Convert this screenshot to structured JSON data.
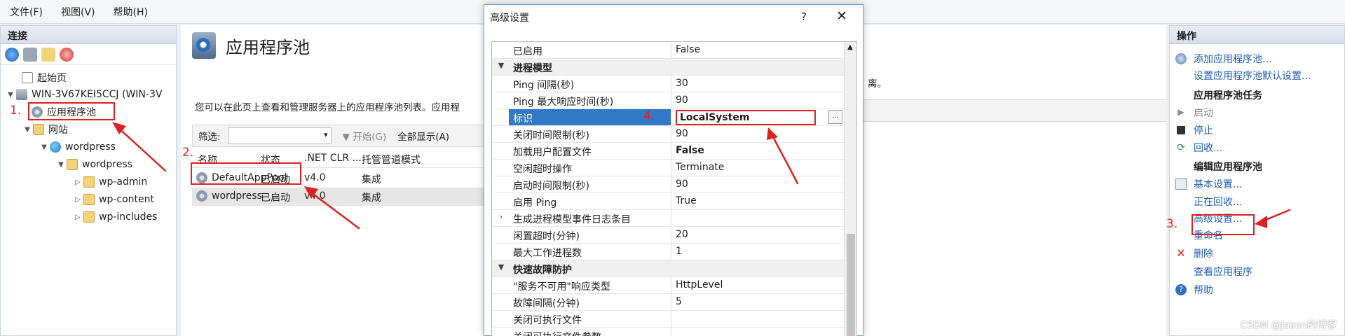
{
  "menubar": {
    "items": [
      "文件(F)",
      "视图(V)",
      "帮助(H)"
    ]
  },
  "connections": {
    "title": "连接",
    "tree": [
      {
        "label": "起始页"
      },
      {
        "label": "WIN-3V67KEI5CCJ (WIN-3V"
      },
      {
        "label": "应用程序池"
      },
      {
        "label": "网站"
      },
      {
        "label": "wordpress"
      },
      {
        "label": "wordpress"
      },
      {
        "label": "wp-admin"
      },
      {
        "label": "wp-content"
      },
      {
        "label": "wp-includes"
      }
    ]
  },
  "main": {
    "title": "应用程序池",
    "description": "您可以在此页上查看和管理服务器上的应用程序池列表。应用程",
    "filter_label": "筛选:",
    "start_label": "▼ 开始(G)",
    "showall_label": "全部显示(A)",
    "columns": [
      "名称",
      "状态",
      ".NET CLR ...",
      "托管管道模式"
    ],
    "rows": [
      {
        "name": "DefaultAppPool",
        "status": "已启动",
        "clr": "v4.0",
        "pipeline": "集成"
      },
      {
        "name": "wordpress",
        "status": "已启动",
        "clr": "v4.0",
        "pipeline": "集成"
      }
    ],
    "right_fragment": "离。"
  },
  "dialog": {
    "title": "高级设置",
    "help": "?",
    "close": "✕",
    "properties": [
      {
        "name": "已启用",
        "value": "False"
      },
      {
        "name": "进程模型",
        "value": ""
      },
      {
        "name": "Ping 间隔(秒)",
        "value": "30"
      },
      {
        "name": "Ping 最大响应时间(秒)",
        "value": "90"
      },
      {
        "name": "标识",
        "value": "LocalSystem"
      },
      {
        "name": "关闭时间限制(秒)",
        "value": "90"
      },
      {
        "name": "加载用户配置文件",
        "value": "False"
      },
      {
        "name": "空闲超时操作",
        "value": "Terminate"
      },
      {
        "name": "启动时间限制(秒)",
        "value": "90"
      },
      {
        "name": "启用 Ping",
        "value": "True"
      },
      {
        "name": "生成进程模型事件日志条目",
        "value": ""
      },
      {
        "name": "闲置超时(分钟)",
        "value": "20"
      },
      {
        "name": "最大工作进程数",
        "value": "1"
      },
      {
        "name": "快速故障防护",
        "value": ""
      },
      {
        "name": "\"服务不可用\"响应类型",
        "value": "HttpLevel"
      },
      {
        "name": "故障间隔(分钟)",
        "value": "5"
      },
      {
        "name": "关闭可执行文件",
        "value": ""
      },
      {
        "name": "关闭可执行文件参数",
        "value": ""
      }
    ],
    "ellipsis": "..."
  },
  "actions": {
    "title": "操作",
    "add_pool": "添加应用程序池...",
    "set_defaults": "设置应用程序池默认设置...",
    "tasks_header": "应用程序池任务",
    "start": "启动",
    "stop": "停止",
    "recycle": "回收...",
    "edit_header": "编辑应用程序池",
    "basic": "基本设置...",
    "recycling": "正在回收...",
    "advanced": "高级设置...",
    "rename": "重命名",
    "delete": "删除",
    "view_apps": "查看应用程序",
    "help": "帮助"
  },
  "annotations": {
    "n1": "1.",
    "n2": "2.",
    "n3": "3.",
    "n4": "4."
  },
  "watermark": "CSDN @Jason的博客",
  "colors": {
    "annotation_red": "#e02020",
    "selection_blue": "#3178c6",
    "link_blue": "#1f5fb4"
  }
}
